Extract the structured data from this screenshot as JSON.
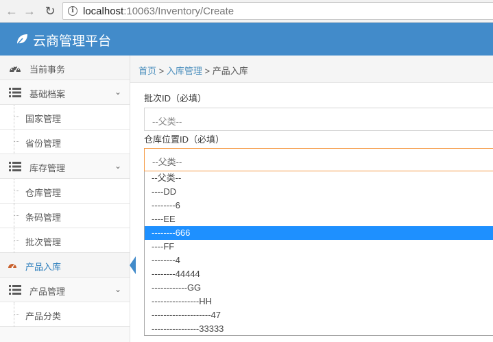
{
  "browser": {
    "url_host": "localhost",
    "url_rest": ":10063/Inventory/Create"
  },
  "app": {
    "title": "云商管理平台"
  },
  "sidebar": {
    "current_affairs": "当前事务",
    "basic_archive": {
      "label": "基础档案",
      "items": [
        "国家管理",
        "省份管理"
      ]
    },
    "stock_mgmt": {
      "label": "库存管理",
      "items": [
        "仓库管理",
        "条码管理",
        "批次管理"
      ]
    },
    "active_item": "产品入库",
    "product_mgmt": {
      "label": "产品管理",
      "items": [
        "产品分类"
      ]
    }
  },
  "breadcrumb": {
    "home": "首页",
    "sep1": " > ",
    "section": "入库管理",
    "sep2": " > ",
    "current": "产品入库"
  },
  "form": {
    "batch_label": "批次ID（必填）",
    "batch_value": "--父类--",
    "location_label": "仓库位置ID（必填）",
    "location_value": "--父类--",
    "location_options": [
      "--父类--",
      "----DD",
      "--------6",
      "----EE",
      "--------666",
      "----FF",
      "--------4",
      "--------44444",
      "------------GG",
      "----------------HH",
      "--------------------47",
      "----------------33333"
    ],
    "highlighted_option_index": 4
  },
  "colors": {
    "header_bg": "#428bca",
    "link": "#4c8fbd",
    "focus_border": "#f59942",
    "option_highlight": "#1e90ff"
  },
  "icons": {
    "back": "arrow-left-icon",
    "forward": "arrow-right-icon",
    "reload": "reload-icon",
    "info": "info-icon",
    "logo": "leaf-icon",
    "dashboard": "tachometer-icon",
    "list": "list-icon",
    "chevron": "chevron-down-icon"
  }
}
